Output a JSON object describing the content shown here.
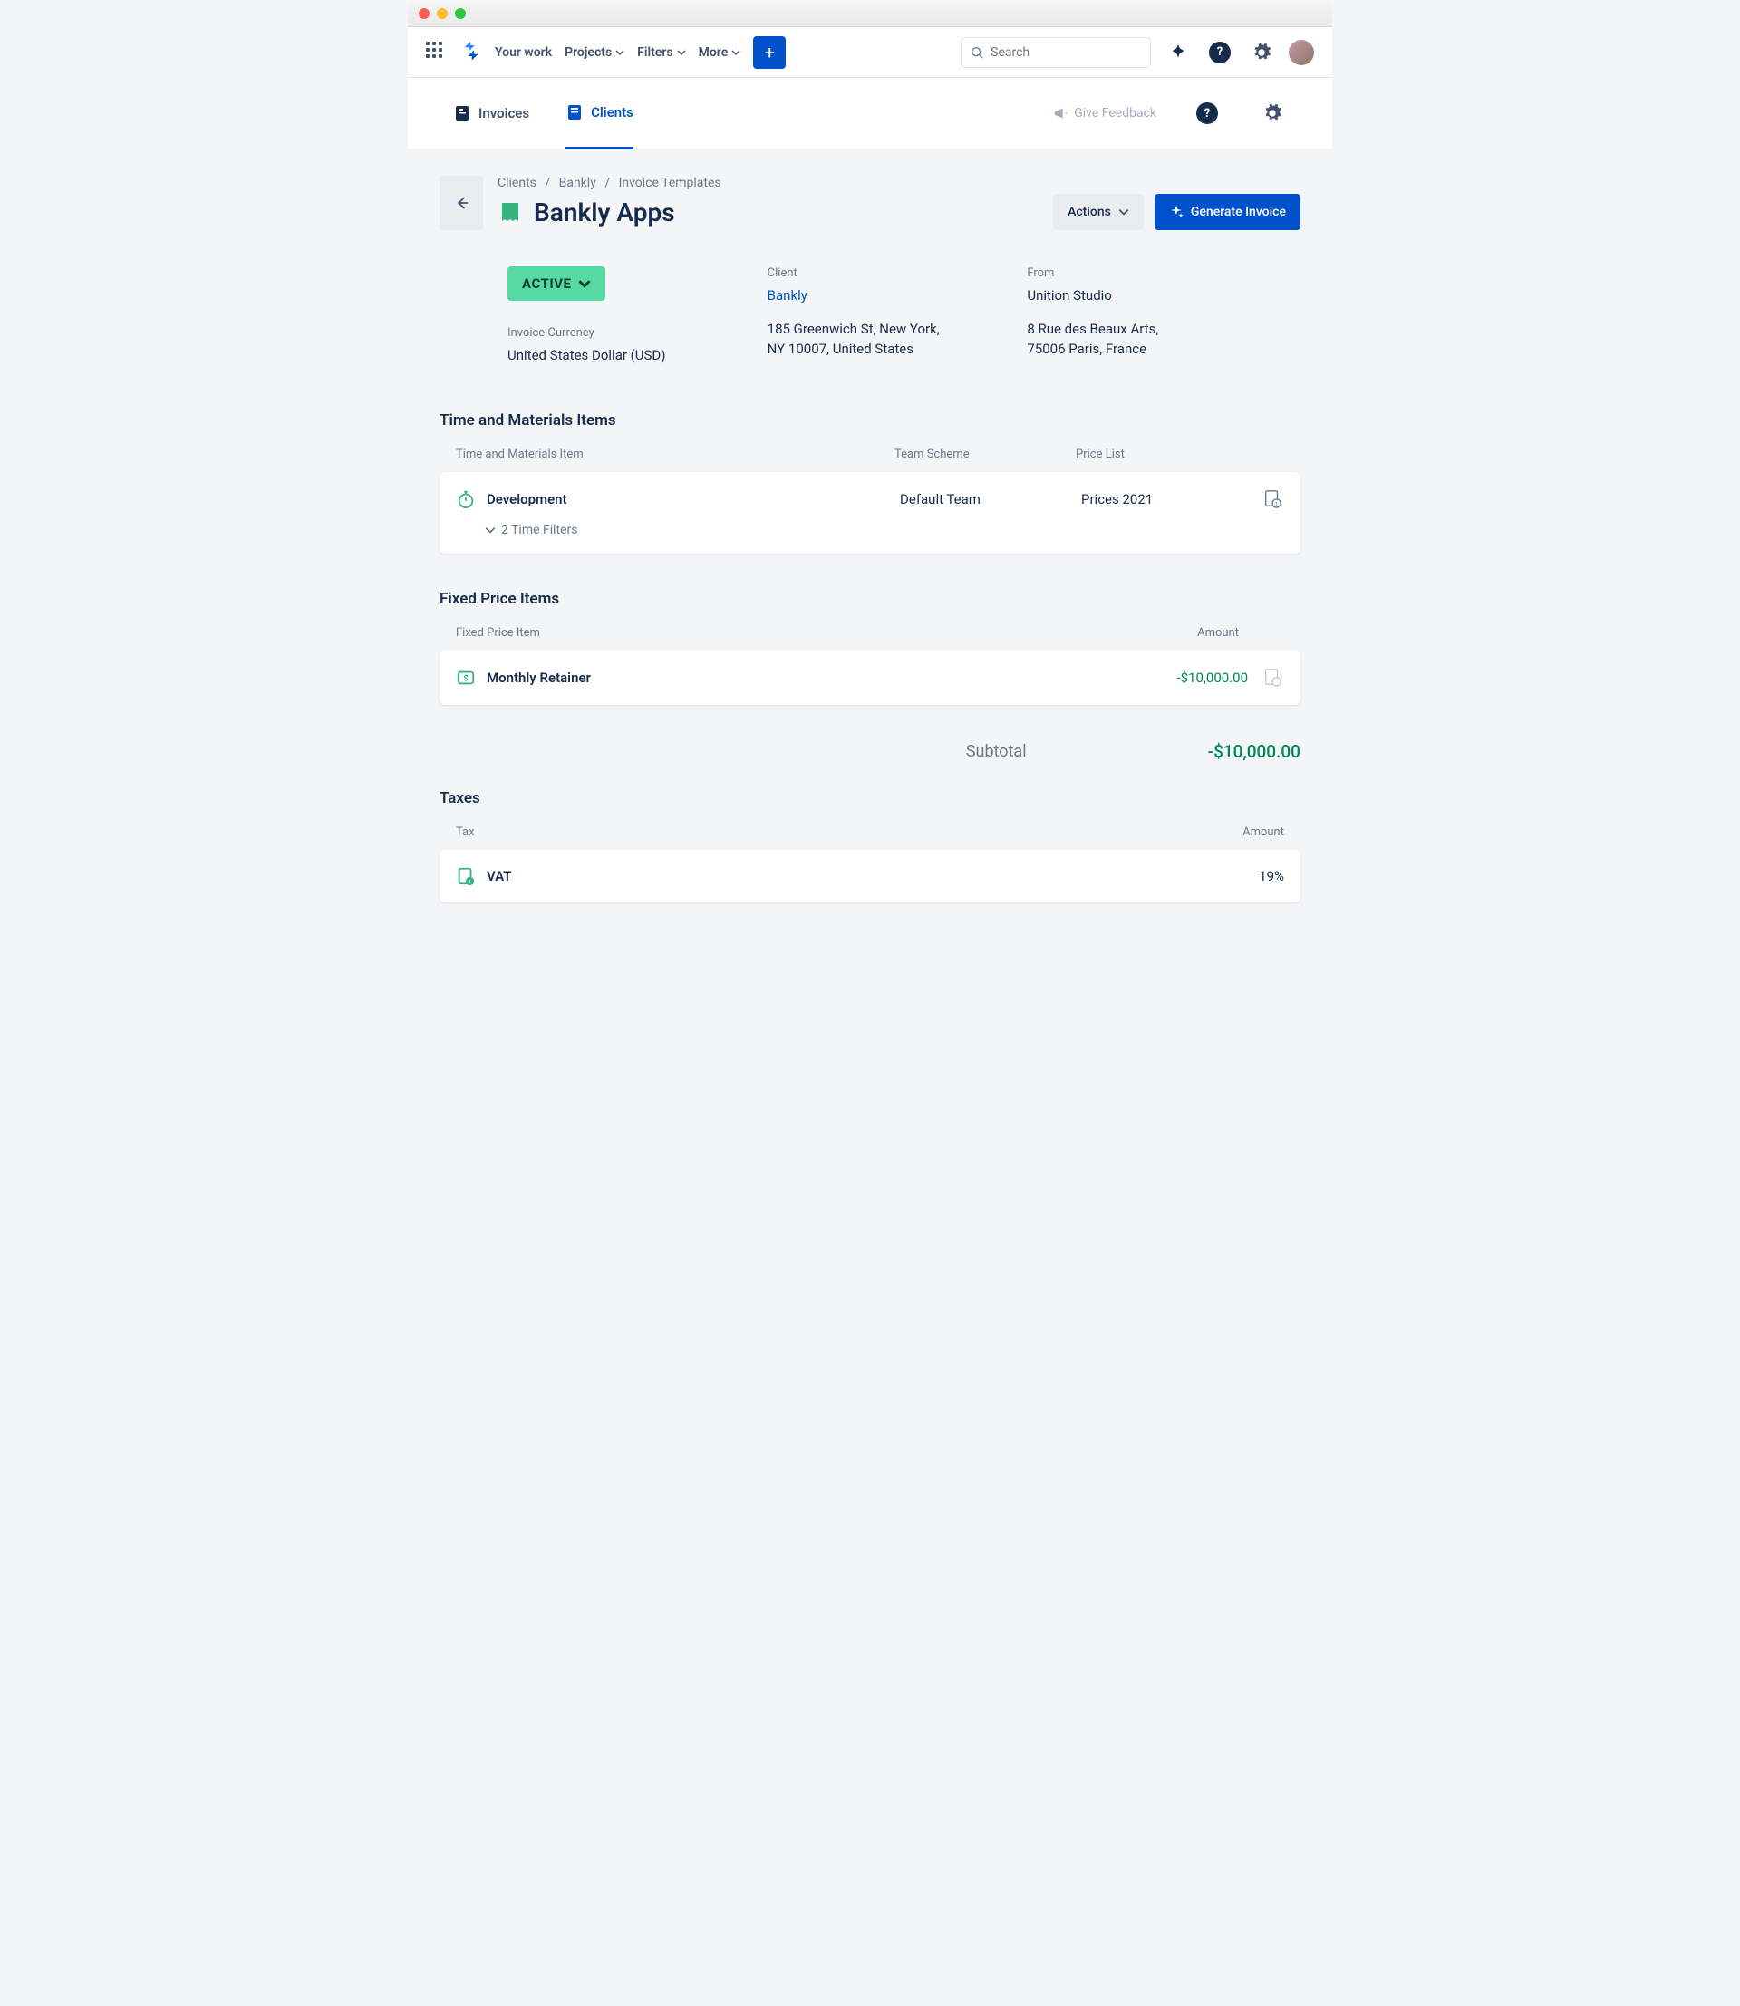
{
  "topnav": {
    "your_work": "Your work",
    "projects": "Projects",
    "filters": "Filters",
    "more": "More",
    "search_placeholder": "Search"
  },
  "subnav": {
    "invoices": "Invoices",
    "clients": "Clients",
    "feedback": "Give Feedback"
  },
  "breadcrumb": {
    "clients": "Clients",
    "bankly": "Bankly",
    "templates": "Invoice Templates"
  },
  "page": {
    "title": "Bankly Apps",
    "actions_btn": "Actions",
    "generate_btn": "Generate Invoice"
  },
  "info": {
    "status": "ACTIVE",
    "currency_label": "Invoice Currency",
    "currency_value": "United States Dollar (USD)",
    "client_label": "Client",
    "client_name": "Bankly",
    "client_address_line1": "185 Greenwich St, New York,",
    "client_address_line2": "NY 10007, United States",
    "from_label": "From",
    "from_name": "Unition Studio",
    "from_address_line1": "8 Rue des Beaux Arts,",
    "from_address_line2": "75006 Paris, France"
  },
  "tm": {
    "title": "Time and Materials Items",
    "col_item": "Time and Materials Item",
    "col_team": "Team Scheme",
    "col_price": "Price List",
    "item_name": "Development",
    "item_team": "Default Team",
    "item_price": "Prices 2021",
    "filters": "2 Time Filters"
  },
  "fp": {
    "title": "Fixed Price Items",
    "col_item": "Fixed Price Item",
    "col_amount": "Amount",
    "item_name": "Monthly Retainer",
    "item_amount": "-$10,000.00",
    "subtotal_label": "Subtotal",
    "subtotal_value": "-$10,000.00"
  },
  "tax": {
    "title": "Taxes",
    "col_tax": "Tax",
    "col_amount": "Amount",
    "item_name": "VAT",
    "item_amount": "19%"
  }
}
